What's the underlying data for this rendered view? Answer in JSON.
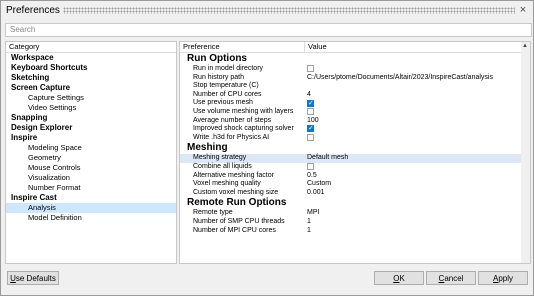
{
  "window": {
    "title": "Preferences",
    "close_glyph": "×"
  },
  "search": {
    "placeholder": "Search"
  },
  "left": {
    "header": "Category",
    "items": [
      {
        "label": "Workspace",
        "level": 0
      },
      {
        "label": "Keyboard Shortcuts",
        "level": 0
      },
      {
        "label": "Sketching",
        "level": 0
      },
      {
        "label": "Screen Capture",
        "level": 0
      },
      {
        "label": "Capture Settings",
        "level": 1
      },
      {
        "label": "Video Settings",
        "level": 1
      },
      {
        "label": "Snapping",
        "level": 0
      },
      {
        "label": "Design Explorer",
        "level": 0
      },
      {
        "label": "Inspire",
        "level": 0
      },
      {
        "label": "Modeling Space",
        "level": 1
      },
      {
        "label": "Geometry",
        "level": 1
      },
      {
        "label": "Mouse Controls",
        "level": 1
      },
      {
        "label": "Visualization",
        "level": 1
      },
      {
        "label": "Number Format",
        "level": 1
      },
      {
        "label": "Inspire Cast",
        "level": 0
      },
      {
        "label": "Analysis",
        "level": 1,
        "selected": true
      },
      {
        "label": "Model Definition",
        "level": 1
      }
    ]
  },
  "right": {
    "header_pref": "Preference",
    "header_value": "Value",
    "sections": [
      {
        "title": "Run Options",
        "rows": [
          {
            "label": "Run in model directory",
            "type": "checkbox",
            "checked": false
          },
          {
            "label": "Run history path",
            "type": "text",
            "value": "C:/Users/ptome/Documents/Altair/2023/InspireCast/analysis"
          },
          {
            "label": "Stop temperature (C)",
            "type": "text",
            "value": ""
          },
          {
            "label": "Number of CPU cores",
            "type": "text",
            "value": "4"
          },
          {
            "label": "Use previous mesh",
            "type": "checkbox",
            "checked": true
          },
          {
            "label": "Use volume meshing with layers",
            "type": "checkbox",
            "checked": false
          },
          {
            "label": "Average number of steps",
            "type": "text",
            "value": "100"
          },
          {
            "label": "Improved shock capturing solver",
            "type": "checkbox",
            "checked": true
          },
          {
            "label": "Write .h3d for Physics AI",
            "type": "checkbox",
            "checked": false
          }
        ]
      },
      {
        "title": "Meshing",
        "rows": [
          {
            "label": "Meshing strategy",
            "type": "text",
            "value": "Default mesh",
            "highlight": true
          },
          {
            "label": "Combine all liquids",
            "type": "checkbox",
            "checked": false
          },
          {
            "label": "Alternative meshing factor",
            "type": "text",
            "value": "0.5"
          },
          {
            "label": "Voxel meshing quality",
            "type": "text",
            "value": "Custom"
          },
          {
            "label": "Custom voxel meshing size",
            "type": "text",
            "value": "0.001"
          }
        ]
      },
      {
        "title": "Remote Run Options",
        "rows": [
          {
            "label": "Remote type",
            "type": "text",
            "value": "MPI"
          },
          {
            "label": "Number of SMP CPU threads",
            "type": "text",
            "value": "1"
          },
          {
            "label": "Number of MPI CPU cores",
            "type": "text",
            "value": "1"
          }
        ]
      }
    ]
  },
  "buttons": {
    "use_defaults": {
      "first": "U",
      "rest": "se Defaults"
    },
    "ok": {
      "first": "O",
      "rest": "K"
    },
    "cancel": {
      "first": "C",
      "rest": "ancel"
    },
    "apply": {
      "first": "A",
      "rest": "pply"
    }
  },
  "colors": {
    "selection": "#cce8ff",
    "checkbox_checked": "#0a78d7",
    "highlight_row": "#dce8f5"
  }
}
